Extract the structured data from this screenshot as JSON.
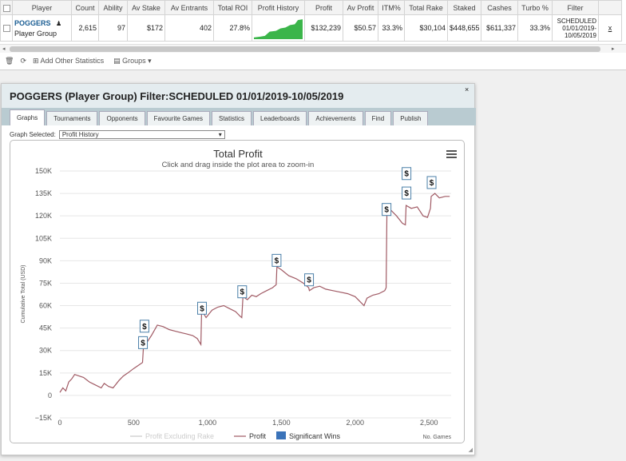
{
  "grid": {
    "headers": [
      "",
      "Player",
      "Count",
      "Ability",
      "Av Stake",
      "Av Entrants",
      "Total ROI",
      "Profit History",
      "Profit",
      "Av Profit",
      "ITM%",
      "Total Rake",
      "Staked",
      "Cashes",
      "Turbo %",
      "Filter",
      ""
    ],
    "row": {
      "player_name": "POGGERS",
      "player_type": "Player Group",
      "count": "2,615",
      "ability": "97",
      "av_stake": "$172",
      "av_entrants": "402",
      "total_roi": "27.8%",
      "profit": "$132,239",
      "av_profit": "$50.57",
      "itm": "33.3%",
      "total_rake": "$30,104",
      "staked": "$448,655",
      "cashes": "$611,337",
      "turbo": "33.3%",
      "filter_l1": "SCHEDULED",
      "filter_l2": "01/01/2019-",
      "filter_l3": "10/05/2019",
      "remove": "x"
    },
    "toolbar": {
      "add_stats": "Add Other Statistics",
      "groups": "Groups ▾"
    }
  },
  "window": {
    "title": "POGGERS (Player Group) Filter:SCHEDULED 01/01/2019-10/05/2019",
    "close": "×",
    "tabs": [
      "Graphs",
      "Tournaments",
      "Opponents",
      "Favourite Games",
      "Statistics",
      "Leaderboards",
      "Achievements",
      "Find",
      "Publish"
    ],
    "graph_selected_label": "Graph Selected:",
    "graph_selected_value": "Profit History"
  },
  "chart_data": {
    "type": "line",
    "title": "Total Profit",
    "subtitle": "Click and drag inside the plot area to zoom-in",
    "xlabel": "No. Games",
    "ylabel": "Cumulative Total (USD)",
    "xlim": [
      0,
      2650
    ],
    "ylim": [
      -15000,
      150000
    ],
    "x_ticks": [
      0,
      500,
      1000,
      1500,
      2000,
      2500
    ],
    "x_tick_labels": [
      "0",
      "500",
      "1,000",
      "1,500",
      "2,000",
      "2,500"
    ],
    "y_ticks": [
      -15000,
      0,
      15000,
      30000,
      45000,
      60000,
      75000,
      90000,
      105000,
      120000,
      135000,
      150000
    ],
    "y_tick_labels": [
      "−15K",
      "0",
      "15K",
      "30K",
      "45K",
      "60K",
      "75K",
      "90K",
      "105K",
      "120K",
      "135K",
      "150K"
    ],
    "legend": [
      "Profit Excluding Rake",
      "Profit",
      "Significant Wins"
    ],
    "legend_position": "bottom",
    "series": [
      {
        "name": "Profit",
        "x": [
          0,
          20,
          40,
          60,
          80,
          100,
          130,
          160,
          200,
          240,
          280,
          300,
          330,
          360,
          400,
          430,
          460,
          500,
          530,
          560,
          565,
          580,
          620,
          660,
          700,
          740,
          780,
          820,
          860,
          900,
          930,
          955,
          960,
          990,
          1030,
          1070,
          1110,
          1150,
          1190,
          1220,
          1232,
          1240,
          1270,
          1300,
          1330,
          1360,
          1400,
          1440,
          1465,
          1470,
          1500,
          1550,
          1600,
          1650,
          1685,
          1690,
          1720,
          1760,
          1800,
          1850,
          1900,
          1950,
          2000,
          2040,
          2060,
          2080,
          2120,
          2160,
          2200,
          2210,
          2215,
          2240,
          2280,
          2320,
          2340,
          2345,
          2380,
          2420,
          2460,
          2490,
          2510,
          2515,
          2540,
          2570,
          2610,
          2640
        ],
        "y": [
          2000,
          5000,
          3000,
          9000,
          11000,
          14000,
          13000,
          12000,
          9000,
          7000,
          5000,
          8000,
          6000,
          5000,
          10000,
          13000,
          15000,
          18000,
          20000,
          22000,
          31000,
          34000,
          40000,
          47000,
          46000,
          44000,
          43000,
          42000,
          41000,
          40000,
          38000,
          34000,
          57000,
          52000,
          57000,
          59000,
          60000,
          58000,
          56000,
          53000,
          52000,
          66000,
          64000,
          67000,
          66000,
          68000,
          70000,
          72000,
          74000,
          86000,
          84000,
          80000,
          78000,
          75000,
          72000,
          70000,
          72000,
          73000,
          71000,
          70000,
          69000,
          68000,
          66000,
          62000,
          60000,
          65000,
          67000,
          68000,
          70000,
          72000,
          124000,
          124000,
          120000,
          115000,
          114000,
          127000,
          125000,
          126000,
          120000,
          119000,
          125000,
          133000,
          135000,
          132000,
          133000,
          133000
        ]
      }
    ],
    "significant_wins": [
      {
        "x": 560,
        "y": 35000
      },
      {
        "x": 570,
        "y": 46000
      },
      {
        "x": 960,
        "y": 58000
      },
      {
        "x": 1232,
        "y": 69000
      },
      {
        "x": 1465,
        "y": 90000
      },
      {
        "x": 1685,
        "y": 77000
      },
      {
        "x": 2210,
        "y": 124000
      },
      {
        "x": 2345,
        "y": 135000
      },
      {
        "x": 2345,
        "y": 148000
      },
      {
        "x": 2515,
        "y": 142000
      }
    ],
    "win_marker_label": "$",
    "grid": true
  },
  "colors": {
    "profit_line": "#a05a64",
    "profit_ex_rake": "#c8c8c8",
    "significant_wins": "#3b73b9",
    "history_fill": "#3bb54a",
    "header_bg": "#e4ecef",
    "tab_bar": "#b9cbd1"
  }
}
